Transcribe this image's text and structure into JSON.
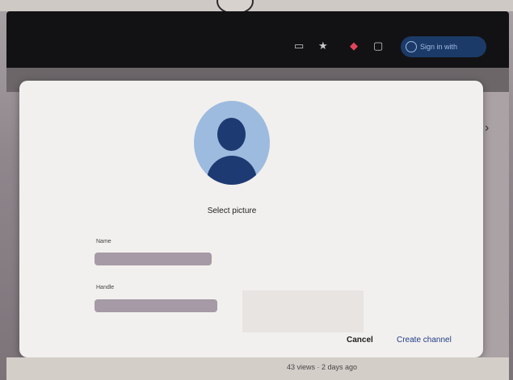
{
  "browser": {
    "toolbar_icons": [
      "cast-icon",
      "star-icon",
      "extension-icon",
      "puzzle-icon"
    ],
    "signin": {
      "label": "Sign in with"
    }
  },
  "dialog": {
    "select_picture_label": "Select picture",
    "name_field": {
      "label": "Name",
      "value": ""
    },
    "handle_field": {
      "label": "Handle",
      "value": ""
    },
    "buttons": {
      "cancel": "Cancel",
      "create": "Create channel"
    }
  },
  "background": {
    "video_meta": "43 views · 2 days ago"
  },
  "colors": {
    "avatar_bg": "#9dbbde",
    "avatar_fg": "#1e3a72",
    "primary_button_text": "#1f3d85",
    "signin_bg": "#1c3a67"
  }
}
